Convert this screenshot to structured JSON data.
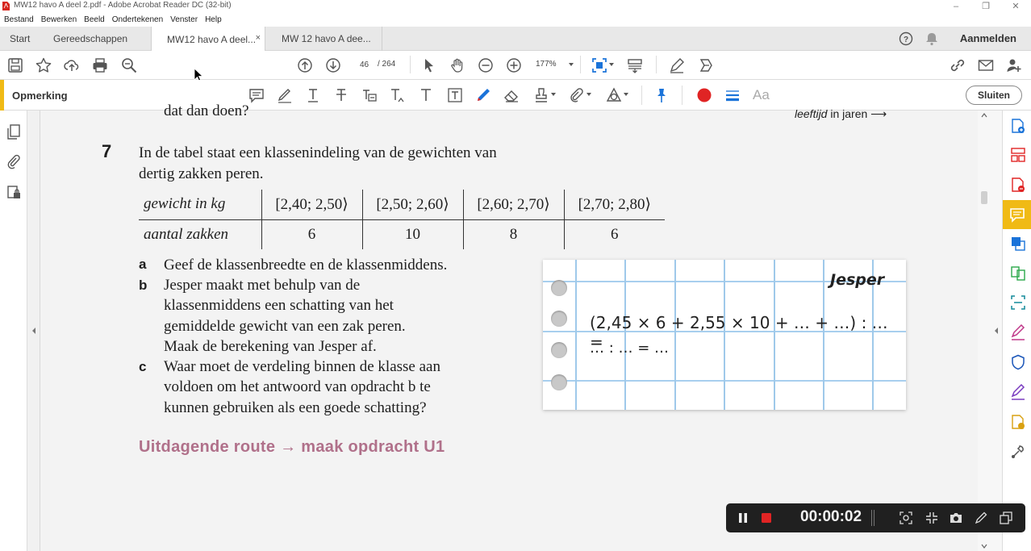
{
  "window": {
    "title": "MW12 havo A deel 2.pdf - Adobe Acrobat Reader DC (32-bit)",
    "controls": [
      "–",
      "❐",
      "✕"
    ]
  },
  "menu": [
    "Bestand",
    "Bewerken",
    "Beeld",
    "Ondertekenen",
    "Venster",
    "Help"
  ],
  "tabs": {
    "home": "Start",
    "tools": "Gereedschappen",
    "doc1": "MW12 havo A deel...",
    "doc2": "MW 12 havo A dee...",
    "close": "×",
    "signin": "Aanmelden"
  },
  "toolbar": {
    "page_current": "46",
    "page_total": "/  264",
    "zoom": "177%"
  },
  "comment_toolbar": {
    "label": "Opmerking",
    "close": "Sluiten",
    "font_label": "Aa"
  },
  "document": {
    "top_cut": "dat dan doen?",
    "top_right_cut_italic": "leeftijd",
    "top_right_cut_rest": "in jaren ⟶",
    "question_number": "7",
    "question_line1": "In de tabel staat een klassenindeling van de gewichten van",
    "question_line2": "dertig zakken peren.",
    "table": {
      "header_row_label_italic": "gewicht",
      "header_row_label_rest": "in kg",
      "classes": [
        "[2,40; 2,50⟩",
        "[2,50; 2,60⟩",
        "[2,60; 2,70⟩",
        "[2,70; 2,80⟩"
      ],
      "count_row_label": "aantal zakken",
      "counts": [
        "6",
        "10",
        "8",
        "6"
      ]
    },
    "sub_a_label": "a",
    "sub_a": "Geef de klassenbreedte en de klassenmiddens.",
    "sub_b_label": "b",
    "sub_b_lines": [
      "Jesper maakt met behulp van de",
      "klassenmiddens een schatting van het",
      "gemiddelde gewicht van een zak peren.",
      "Maak de berekening van Jesper af."
    ],
    "sub_c_label": "c",
    "sub_c_lines": [
      "Waar moet de verdeling binnen de klasse aan",
      "voldoen om het antwoord van opdracht b te",
      "kunnen gebruiken als een goede schatting?"
    ],
    "note": {
      "name": "Jesper",
      "line1": "(2,45 × 6 + 2,55 × 10 + … + …) : … =",
      "line2": "… : … = …"
    },
    "challenge": "Uitdagende route → maak opdracht U1"
  },
  "recorder": {
    "time": "00:00:02"
  },
  "colors": {
    "accent_yellow": "#f0ba15",
    "comment_blue": "#1a73d9",
    "record_red": "#e02424",
    "challenge_pink": "#b0708a",
    "grid_blue": "#9fc9ea"
  }
}
